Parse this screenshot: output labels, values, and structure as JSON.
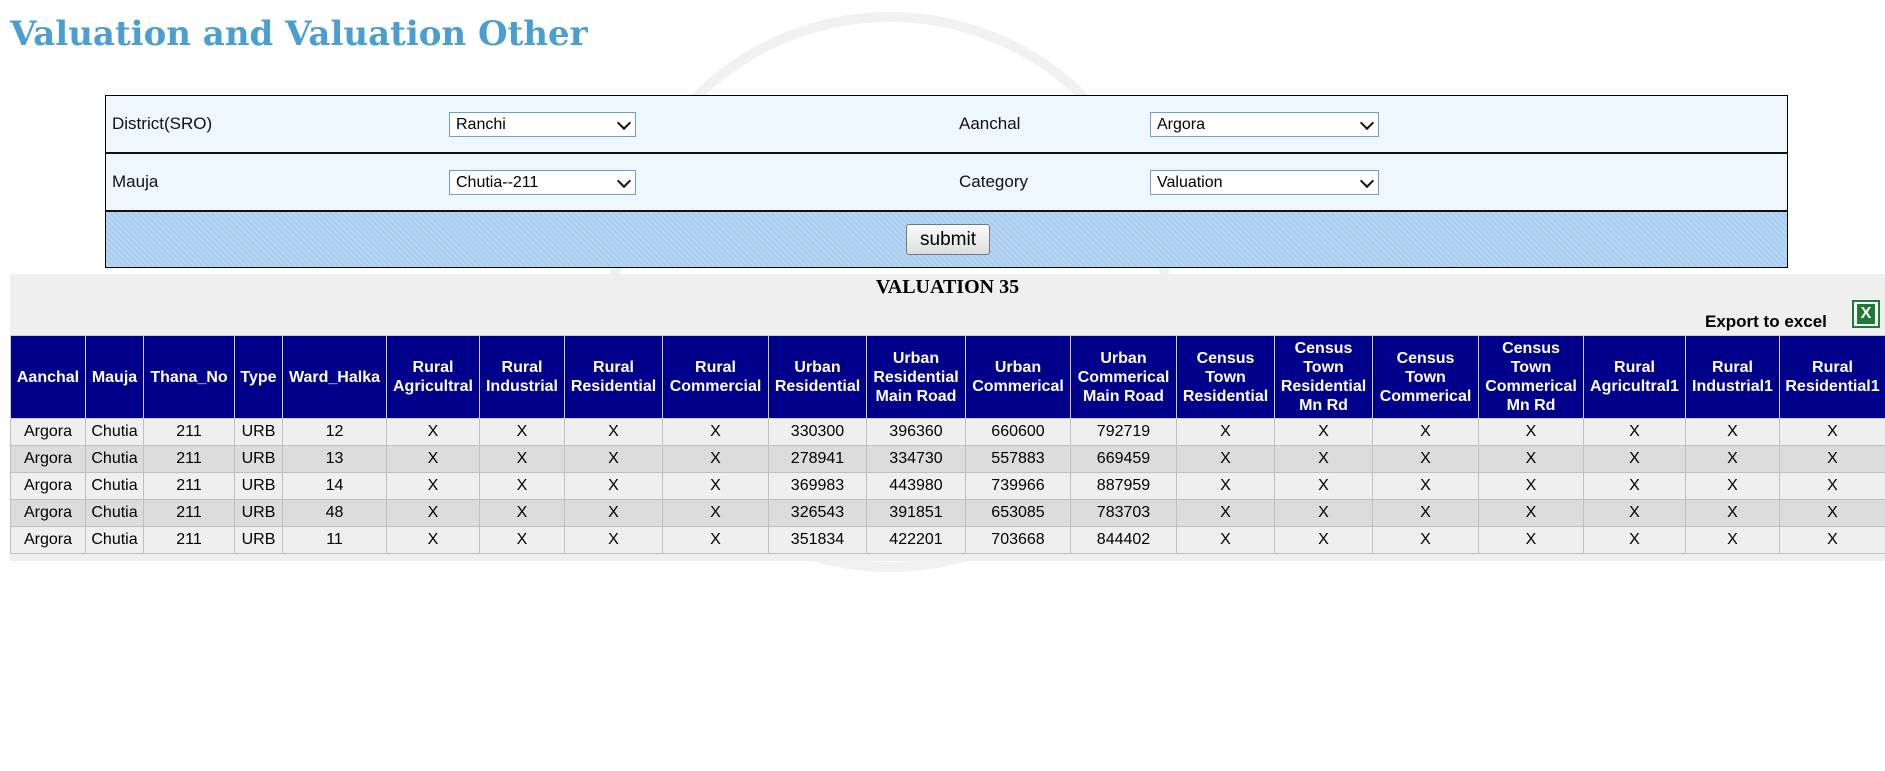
{
  "page": {
    "title": "Valuation and Valuation Other"
  },
  "form": {
    "district_label": "District(SRO)",
    "district_value": "Ranchi",
    "aanchal_label": "Aanchal",
    "aanchal_value": "Argora",
    "mauja_label": "Mauja",
    "mauja_value": "Chutia--211",
    "category_label": "Category",
    "category_value": "Valuation",
    "submit_label": "submit"
  },
  "result": {
    "title": "VALUATION 35",
    "export_label": "Export to excel",
    "export_icon": "excel-icon",
    "columns": [
      "Aanchal",
      "Mauja",
      "Thana_No",
      "Type",
      "Ward_Halka",
      "Rural Agricultral",
      "Rural Industrial",
      "Rural Residential",
      "Rural Commercial",
      "Urban Residential",
      "Urban Residential Main Road",
      "Urban Commerical",
      "Urban Commerical Main Road",
      "Census Town Residential",
      "Census Town Residential Mn Rd",
      "Census Town Commerical",
      "Census Town Commerical Mn Rd",
      "Rural Agricultral1",
      "Rural Industrial1",
      "Rural Residential1"
    ],
    "rows": [
      [
        "Argora",
        "Chutia",
        "211",
        "URB",
        "12",
        "X",
        "X",
        "X",
        "X",
        "330300",
        "396360",
        "660600",
        "792719",
        "X",
        "X",
        "X",
        "X",
        "X",
        "X",
        "X"
      ],
      [
        "Argora",
        "Chutia",
        "211",
        "URB",
        "13",
        "X",
        "X",
        "X",
        "X",
        "278941",
        "334730",
        "557883",
        "669459",
        "X",
        "X",
        "X",
        "X",
        "X",
        "X",
        "X"
      ],
      [
        "Argora",
        "Chutia",
        "211",
        "URB",
        "14",
        "X",
        "X",
        "X",
        "X",
        "369983",
        "443980",
        "739966",
        "887959",
        "X",
        "X",
        "X",
        "X",
        "X",
        "X",
        "X"
      ],
      [
        "Argora",
        "Chutia",
        "211",
        "URB",
        "48",
        "X",
        "X",
        "X",
        "X",
        "326543",
        "391851",
        "653085",
        "783703",
        "X",
        "X",
        "X",
        "X",
        "X",
        "X",
        "X"
      ],
      [
        "Argora",
        "Chutia",
        "211",
        "URB",
        "11",
        "X",
        "X",
        "X",
        "X",
        "351834",
        "422201",
        "703668",
        "844402",
        "X",
        "X",
        "X",
        "X",
        "X",
        "X",
        "X"
      ]
    ]
  },
  "colors": {
    "title": "#4a9fd0",
    "header_bg": "#00008b",
    "form_bg": "#eef7fd",
    "submit_bar": "#b0d2f1"
  }
}
